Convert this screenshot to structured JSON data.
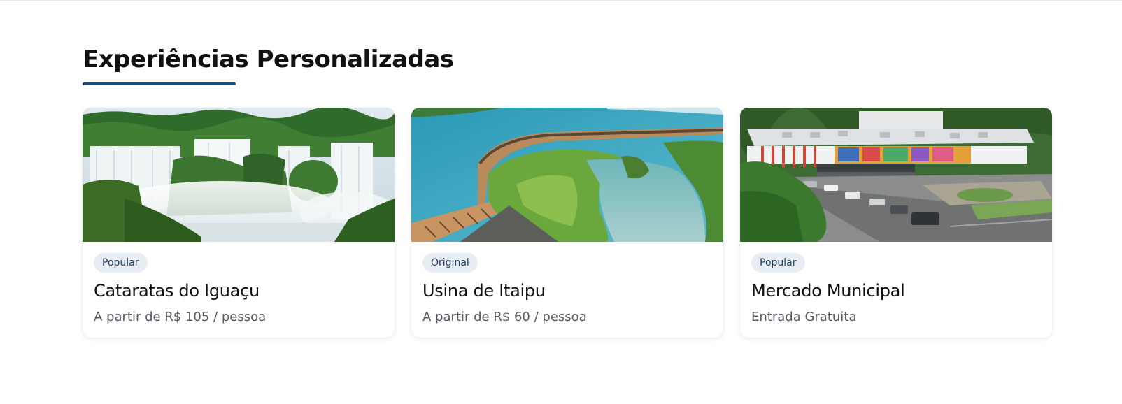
{
  "section": {
    "title": "Experiências Personalizadas",
    "accent_color": "#1e4d7b"
  },
  "cards": [
    {
      "badge": "Popular",
      "title": "Cataratas do Iguaçu",
      "price": "A partir de R$ 105 / pessoa",
      "image": "waterfalls-photo"
    },
    {
      "badge": "Original",
      "title": "Usina de Itaipu",
      "price": "A partir de R$ 60 / pessoa",
      "image": "hydroelectric-dam-photo"
    },
    {
      "badge": "Popular",
      "title": "Mercado Municipal",
      "price": "Entrada Gratuita",
      "image": "municipal-market-photo"
    }
  ]
}
